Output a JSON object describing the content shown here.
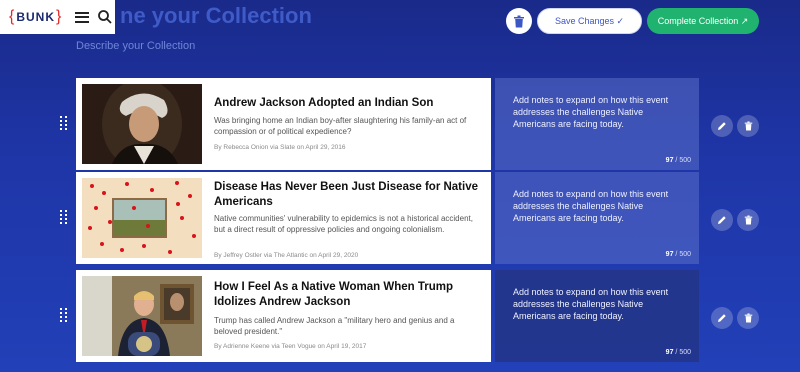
{
  "header": {
    "logo_text": "BUNK",
    "page_title": "ne your Collection",
    "subtitle": "Describe your Collection",
    "save_label": "Save Changes ✓",
    "complete_label": "Complete Collection ↗"
  },
  "colors": {
    "accent": "#3d56c6",
    "complete_green": "#20b370",
    "logo_red": "#e02a2a"
  },
  "rows": [
    {
      "title": "Andrew Jackson Adopted an Indian Son",
      "summary": "Was bringing home an Indian boy-after slaughtering his family-an act of compassion or of political expedience?",
      "byline": "By Rebecca Onion via Slate on April 29, 2016",
      "notes": "Add notes to expand on how this event addresses the challenges Native Americans are facing today.",
      "count": "97",
      "max": "500"
    },
    {
      "title": "Disease Has Never Been Just Disease for Native Americans",
      "summary": "Native communities' vulnerability to epidemics is not a historical accident, but a direct result of oppressive policies and ongoing colonialism.",
      "byline": "By Jeffrey Ostler via The Atlantic on April 29, 2020",
      "notes": "Add notes to expand on how this event addresses the challenges Native Americans are facing today.",
      "count": "97",
      "max": "500"
    },
    {
      "title": "How I Feel As a Native Woman When Trump Idolizes Andrew Jackson",
      "summary": "Trump has called Andrew Jackson a \"military hero and genius and a beloved president.\"",
      "byline": "By Adrienne Keene via Teen Vogue on April 19, 2017",
      "notes": "Add notes to expand on how this event addresses the challenges Native Americans are facing today.",
      "count": "97",
      "max": "500"
    }
  ]
}
